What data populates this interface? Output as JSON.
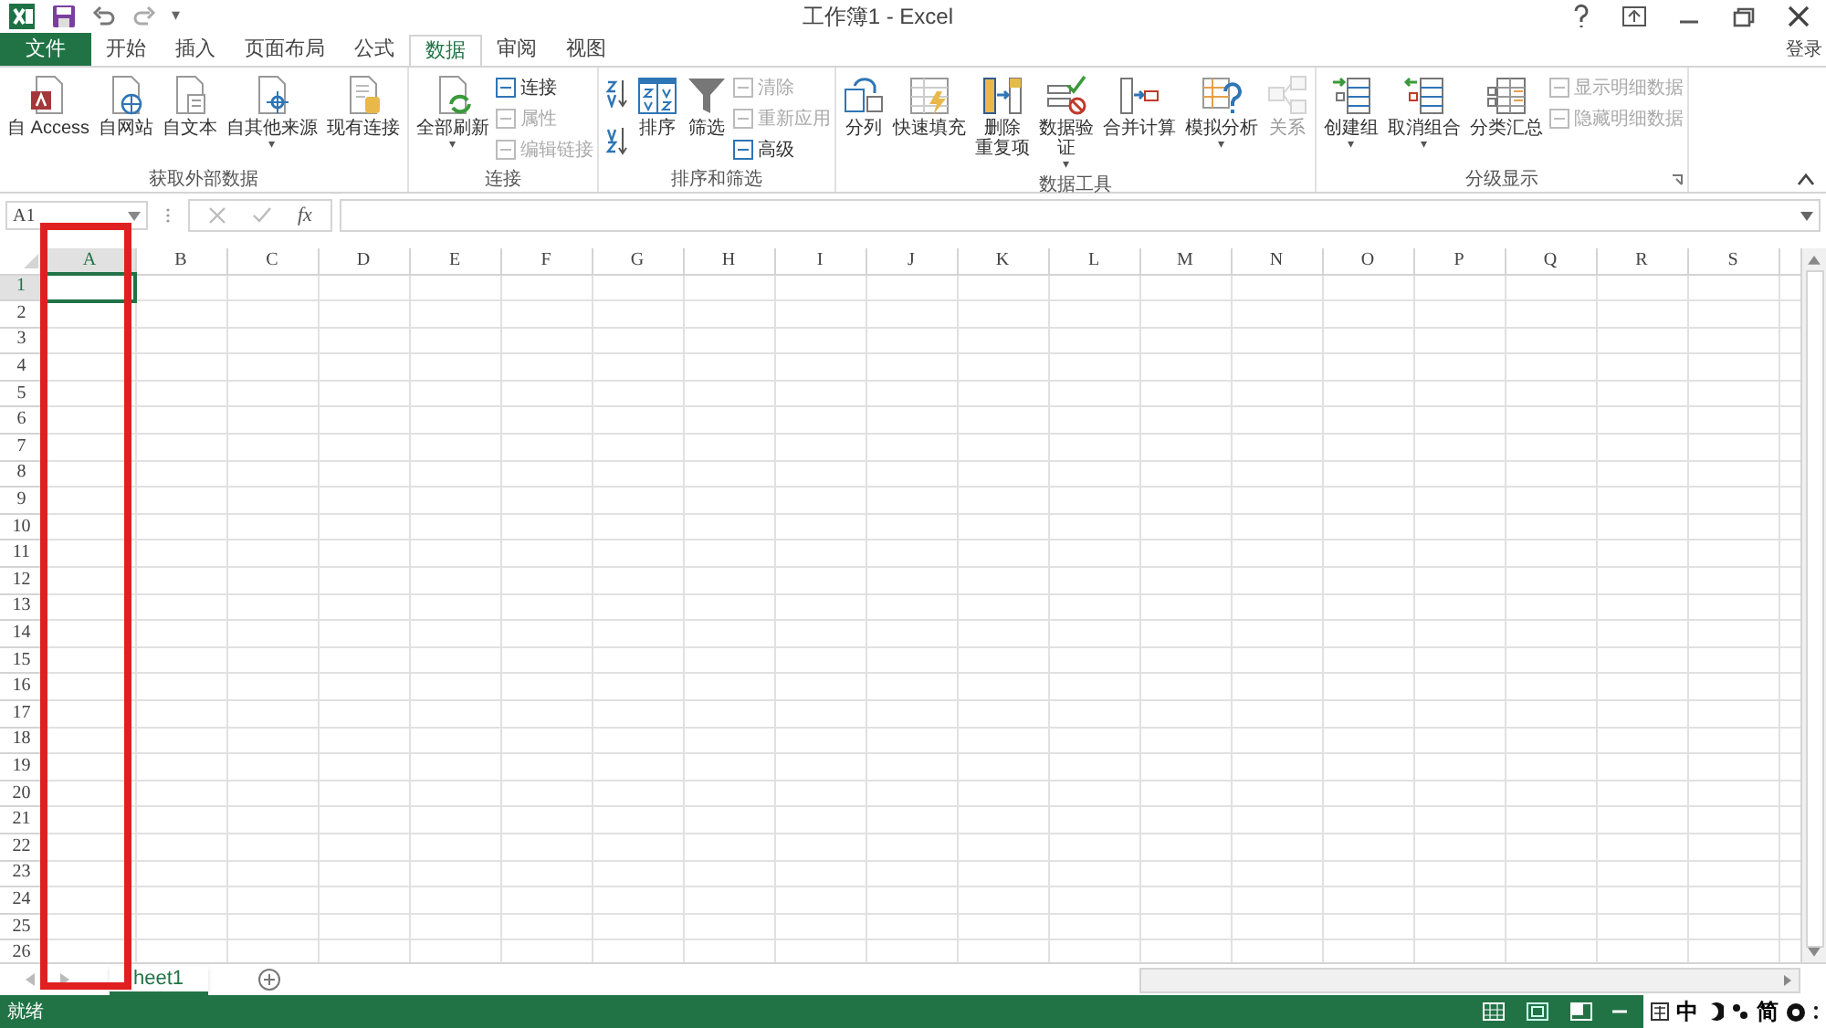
{
  "window": {
    "title": "工作簿1 - Excel",
    "signin": "登录"
  },
  "quick_access": {
    "customize": "▾"
  },
  "tabs": [
    {
      "label": "文件",
      "kind": "file",
      "selected": false
    },
    {
      "label": "开始",
      "kind": "tab",
      "selected": false
    },
    {
      "label": "插入",
      "kind": "tab",
      "selected": false
    },
    {
      "label": "页面布局",
      "kind": "tab",
      "selected": false
    },
    {
      "label": "公式",
      "kind": "tab",
      "selected": false
    },
    {
      "label": "数据",
      "kind": "tab",
      "selected": true
    },
    {
      "label": "审阅",
      "kind": "tab",
      "selected": false
    },
    {
      "label": "视图",
      "kind": "tab",
      "selected": false
    }
  ],
  "ribbon_groups": [
    {
      "title": "获取外部数据",
      "items": [
        {
          "kind": "large",
          "lines": [
            "自 Access"
          ],
          "disabled": false
        },
        {
          "kind": "large",
          "lines": [
            "自网站"
          ],
          "disabled": false
        },
        {
          "kind": "large",
          "lines": [
            "自文本"
          ],
          "disabled": false
        },
        {
          "kind": "large",
          "lines": [
            "自其他来源"
          ],
          "disabled": false,
          "dropdown": "▾"
        },
        {
          "kind": "large",
          "lines": [
            "现有连接"
          ],
          "disabled": false
        }
      ]
    },
    {
      "title": "连接",
      "items": [
        {
          "kind": "large",
          "lines": [
            "全部刷新"
          ],
          "disabled": false,
          "dropdown": "▾"
        },
        {
          "kind": "stack",
          "items": [
            {
              "label": "连接",
              "disabled": false
            },
            {
              "label": "属性",
              "disabled": true
            },
            {
              "label": "编辑链接",
              "disabled": true
            }
          ]
        }
      ]
    },
    {
      "title": "排序和筛选",
      "items": [
        {
          "kind": "sortstack"
        },
        {
          "kind": "large",
          "lines": [
            "排序"
          ],
          "disabled": false
        },
        {
          "kind": "large",
          "lines": [
            "筛选"
          ],
          "disabled": false
        },
        {
          "kind": "stack",
          "items": [
            {
              "label": "清除",
              "disabled": true
            },
            {
              "label": "重新应用",
              "disabled": true
            },
            {
              "label": "高级",
              "disabled": false
            }
          ]
        }
      ]
    },
    {
      "title": "数据工具",
      "items": [
        {
          "kind": "large",
          "lines": [
            "分列"
          ],
          "disabled": false
        },
        {
          "kind": "large",
          "lines": [
            "快速填充"
          ],
          "disabled": false
        },
        {
          "kind": "large",
          "lines": [
            "删除",
            "重复项"
          ],
          "disabled": false
        },
        {
          "kind": "large",
          "lines": [
            "数据验",
            "证"
          ],
          "disabled": false,
          "dropdown": "▾"
        },
        {
          "kind": "large",
          "lines": [
            "合并计算"
          ],
          "disabled": false
        },
        {
          "kind": "large",
          "lines": [
            "模拟分析"
          ],
          "disabled": false,
          "dropdown": "▾"
        },
        {
          "kind": "large",
          "lines": [
            "关系"
          ],
          "disabled": true
        }
      ]
    },
    {
      "title": "分级显示",
      "launcher": true,
      "items": [
        {
          "kind": "large",
          "lines": [
            "创建组"
          ],
          "disabled": false,
          "dropdown": "▾"
        },
        {
          "kind": "large",
          "lines": [
            "取消组合"
          ],
          "disabled": false,
          "dropdown": "▾"
        },
        {
          "kind": "large",
          "lines": [
            "分类汇总"
          ],
          "disabled": false
        },
        {
          "kind": "stack",
          "items": [
            {
              "label": "显示明细数据",
              "disabled": true
            },
            {
              "label": "隐藏明细数据",
              "disabled": true
            }
          ]
        }
      ]
    }
  ],
  "formula_bar": {
    "name_box": "A1",
    "fx": "fx"
  },
  "sheet": {
    "columns": [
      {
        "label": "A",
        "selected": true
      },
      {
        "label": "B",
        "selected": false
      },
      {
        "label": "C",
        "selected": false
      },
      {
        "label": "D",
        "selected": false
      },
      {
        "label": "E",
        "selected": false
      },
      {
        "label": "F",
        "selected": false
      },
      {
        "label": "G",
        "selected": false
      },
      {
        "label": "H",
        "selected": false
      },
      {
        "label": "I",
        "selected": false
      },
      {
        "label": "J",
        "selected": false
      },
      {
        "label": "K",
        "selected": false
      },
      {
        "label": "L",
        "selected": false
      },
      {
        "label": "M",
        "selected": false
      },
      {
        "label": "N",
        "selected": false
      },
      {
        "label": "O",
        "selected": false
      },
      {
        "label": "P",
        "selected": false
      },
      {
        "label": "Q",
        "selected": false
      },
      {
        "label": "R",
        "selected": false
      },
      {
        "label": "S",
        "selected": false
      }
    ],
    "rows": [
      {
        "label": "1",
        "selected": true
      },
      {
        "label": "2",
        "selected": false
      },
      {
        "label": "3",
        "selected": false
      },
      {
        "label": "4",
        "selected": false
      },
      {
        "label": "5",
        "selected": false
      },
      {
        "label": "6",
        "selected": false
      },
      {
        "label": "7",
        "selected": false
      },
      {
        "label": "8",
        "selected": false
      },
      {
        "label": "9",
        "selected": false
      },
      {
        "label": "10",
        "selected": false
      },
      {
        "label": "11",
        "selected": false
      },
      {
        "label": "12",
        "selected": false
      },
      {
        "label": "13",
        "selected": false
      },
      {
        "label": "14",
        "selected": false
      },
      {
        "label": "15",
        "selected": false
      },
      {
        "label": "16",
        "selected": false
      },
      {
        "label": "17",
        "selected": false
      },
      {
        "label": "18",
        "selected": false
      },
      {
        "label": "19",
        "selected": false
      },
      {
        "label": "20",
        "selected": false
      },
      {
        "label": "21",
        "selected": false
      },
      {
        "label": "22",
        "selected": false
      },
      {
        "label": "23",
        "selected": false
      },
      {
        "label": "24",
        "selected": false
      },
      {
        "label": "25",
        "selected": false
      },
      {
        "label": "26",
        "selected": false
      }
    ]
  },
  "sheet_tabs": [
    {
      "label": "heet1",
      "selected": true
    }
  ],
  "status_bar": {
    "text": "就绪"
  },
  "ime_bar": [
    "中",
    "简"
  ]
}
